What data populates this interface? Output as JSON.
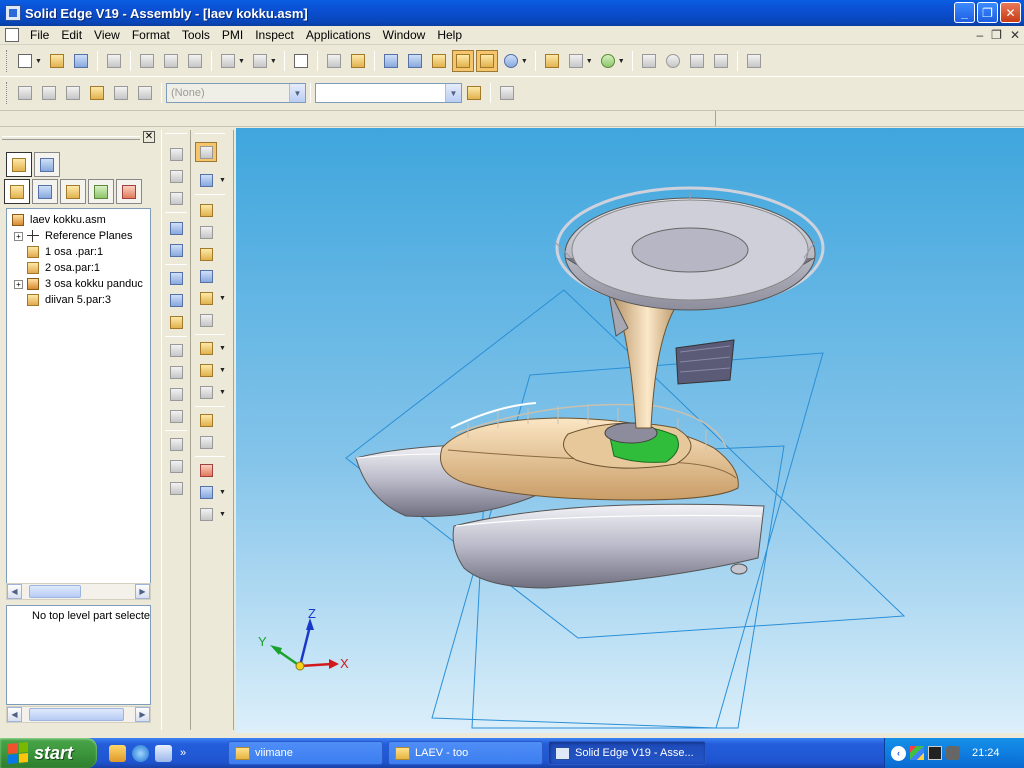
{
  "window": {
    "title": "Solid Edge V19 - Assembly - [laev kokku.asm]",
    "minimize_glyph": "_",
    "maximize_glyph": "❐",
    "close_glyph": "✕"
  },
  "menu": {
    "items": [
      "File",
      "Edit",
      "View",
      "Format",
      "Tools",
      "PMI",
      "Inspect",
      "Applications",
      "Window",
      "Help"
    ],
    "mdi_minimize": "–",
    "mdi_restore": "❐",
    "mdi_close": "✕"
  },
  "toolbar2": {
    "layer_combo_value": "(None)",
    "style_combo_value": ""
  },
  "pathfinder": {
    "close_glyph": "✕",
    "tree": [
      {
        "label": "laev kokku.asm",
        "icon": "assembly-icon",
        "expander": ""
      },
      {
        "label": "Reference Planes",
        "icon": "reference-planes-icon",
        "expander": "+"
      },
      {
        "label": "1 osa .par:1",
        "icon": "part-icon",
        "expander": ""
      },
      {
        "label": "2 osa.par:1",
        "icon": "part-icon",
        "expander": ""
      },
      {
        "label": "3 osa kokku panduc",
        "icon": "subassembly-icon",
        "expander": "+"
      },
      {
        "label": "diivan 5.par:3",
        "icon": "part-icon",
        "expander": ""
      }
    ],
    "status_text": "No top level part selecte",
    "scroll_left": "◀",
    "scroll_right": "▶"
  },
  "triad": {
    "x_label": "X",
    "y_label": "Y",
    "z_label": "Z",
    "x_color": "#d21a1a",
    "y_color": "#1aa32c",
    "z_color": "#1838c8"
  },
  "taskbar": {
    "start_label": "start",
    "quicklaunch_more": "»",
    "tasks": [
      {
        "label": "viimane",
        "icon": "folder-icon"
      },
      {
        "label": "LAEV - too",
        "icon": "folder-icon"
      },
      {
        "label": "Solid Edge V19 - Asse...",
        "icon": "solid-edge-icon"
      }
    ],
    "language": "EN",
    "tray_arrow": "‹",
    "clock": "21:24"
  }
}
